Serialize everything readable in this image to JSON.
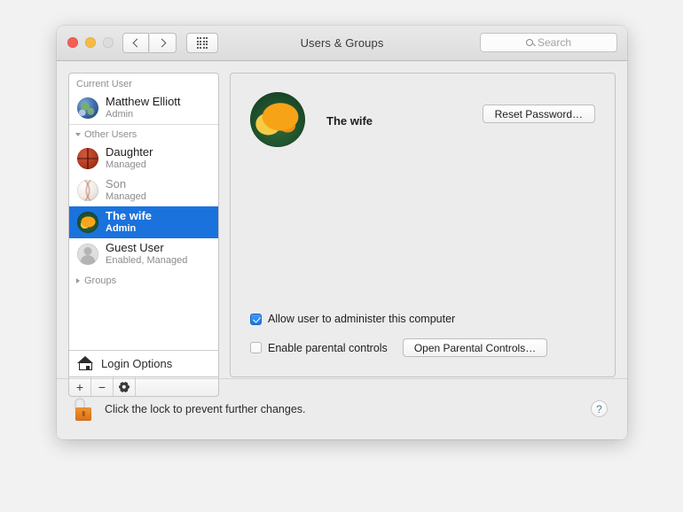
{
  "window": {
    "title": "Users & Groups",
    "traffic_lights": [
      "close",
      "minimize",
      "zoom"
    ],
    "nav": {
      "back": "‹",
      "forward": "›",
      "show_all": "show-all-grid"
    },
    "search": {
      "placeholder": "Search",
      "value": ""
    }
  },
  "sidebar": {
    "groups": [
      {
        "header": "Current User",
        "collapsible": false,
        "users": [
          {
            "name": "Matthew Elliott",
            "role": "Admin",
            "avatar": "globe",
            "selected": false,
            "dim": false
          }
        ]
      },
      {
        "header": "Other Users",
        "collapsible": true,
        "expanded": true,
        "users": [
          {
            "name": "Daughter",
            "role": "Managed",
            "avatar": "basketball",
            "selected": false,
            "dim": false
          },
          {
            "name": "Son",
            "role": "Managed",
            "avatar": "baseball",
            "selected": false,
            "dim": true
          },
          {
            "name": "The wife",
            "role": "Admin",
            "avatar": "flower",
            "selected": true,
            "dim": false
          },
          {
            "name": "Guest User",
            "role": "Enabled, Managed",
            "avatar": "guest",
            "selected": false,
            "dim": false
          }
        ]
      },
      {
        "header": "Groups",
        "collapsible": true,
        "expanded": false,
        "users": []
      }
    ],
    "login_options_label": "Login Options",
    "actions": {
      "add": "+",
      "remove": "−",
      "settings": "gear-icon"
    }
  },
  "detail": {
    "user_name": "The wife",
    "avatar": "flower",
    "reset_password_label": "Reset Password…",
    "checkboxes": [
      {
        "label": "Allow user to administer this computer",
        "checked": true
      },
      {
        "label": "Enable parental controls",
        "checked": false
      }
    ],
    "open_parental_controls_label": "Open Parental Controls…"
  },
  "lockbar": {
    "lock_state": "unlocked",
    "text": "Click the lock to prevent further changes.",
    "help_label": "?"
  },
  "colors": {
    "selection_blue": "#1a72dd",
    "lock_orange": "#e6801f",
    "window_bg": "#ececec",
    "sidebar_bg": "#ffffff",
    "desktop_bg": "#f2f2f2"
  }
}
